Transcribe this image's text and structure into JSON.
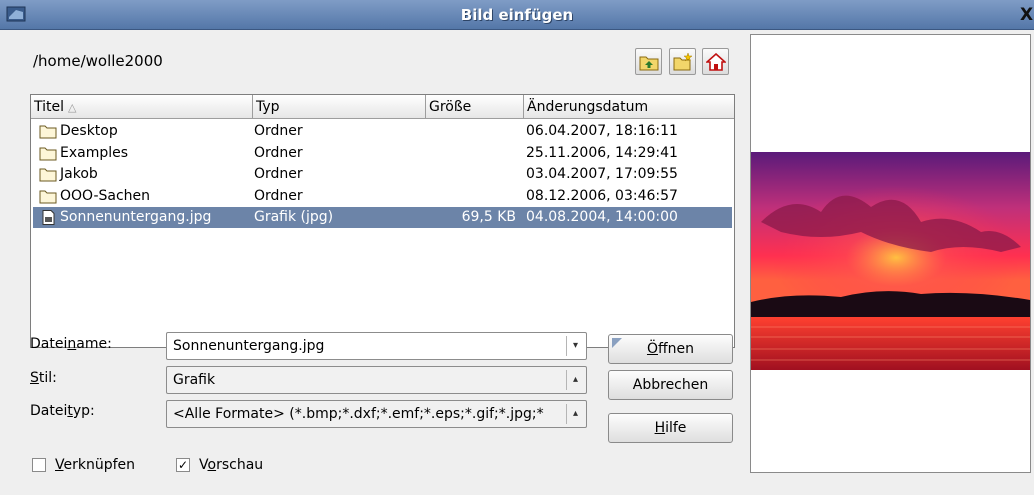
{
  "window": {
    "title": "Bild einfügen",
    "close_glyph": "X"
  },
  "path": "/home/wolle2000",
  "toolbar": {
    "up_icon": "folder-up-icon",
    "new_icon": "new-folder-icon",
    "home_icon": "home-icon"
  },
  "columns": {
    "name": "Titel",
    "sort_indicator": "△",
    "type": "Typ",
    "size": "Größe",
    "date": "Änderungsdatum"
  },
  "files": [
    {
      "name": "Desktop",
      "type": "Ordner",
      "size": "",
      "date": "06.04.2007, 18:16:11",
      "icon": "folder-icon",
      "selected": false
    },
    {
      "name": "Examples",
      "type": "Ordner",
      "size": "",
      "date": "25.11.2006, 14:29:41",
      "icon": "folder-icon",
      "selected": false
    },
    {
      "name": "Jakob",
      "type": "Ordner",
      "size": "",
      "date": "03.04.2007, 17:09:55",
      "icon": "folder-icon",
      "selected": false
    },
    {
      "name": "OOO-Sachen",
      "type": "Ordner",
      "size": "",
      "date": "08.12.2006, 03:46:57",
      "icon": "folder-icon",
      "selected": false
    },
    {
      "name": "Sonnenuntergang.jpg",
      "type": "Grafik (jpg)",
      "size": "69,5 KB",
      "date": "04.08.2004, 14:00:00",
      "icon": "image-file-icon",
      "selected": true
    }
  ],
  "form": {
    "filename_label_pre": "Datei",
    "filename_label_u": "n",
    "filename_label_post": "ame:",
    "filename_value": "Sonnenuntergang.jpg",
    "style_label_u": "S",
    "style_label_post": "til:",
    "style_value": "Grafik",
    "filetype_label_pre": "Datei",
    "filetype_label_u": "t",
    "filetype_label_post": "yp:",
    "filetype_value": "<Alle Formate> (*.bmp;*.dxf;*.emf;*.eps;*.gif;*.jpg;*"
  },
  "buttons": {
    "open_u": "Ö",
    "open_post": "ffnen",
    "cancel": "Abbrechen",
    "help_u": "H",
    "help_post": "ilfe"
  },
  "options": {
    "link_label_u": "V",
    "link_label_post": "erknüpfen",
    "link_checked": false,
    "preview_label_pre": "V",
    "preview_label_u": "o",
    "preview_label_post": "rschau",
    "preview_checked": true,
    "check_glyph": "✓"
  },
  "colors": {
    "selection": "#6c84a8",
    "titlebar": "#5477a8"
  }
}
